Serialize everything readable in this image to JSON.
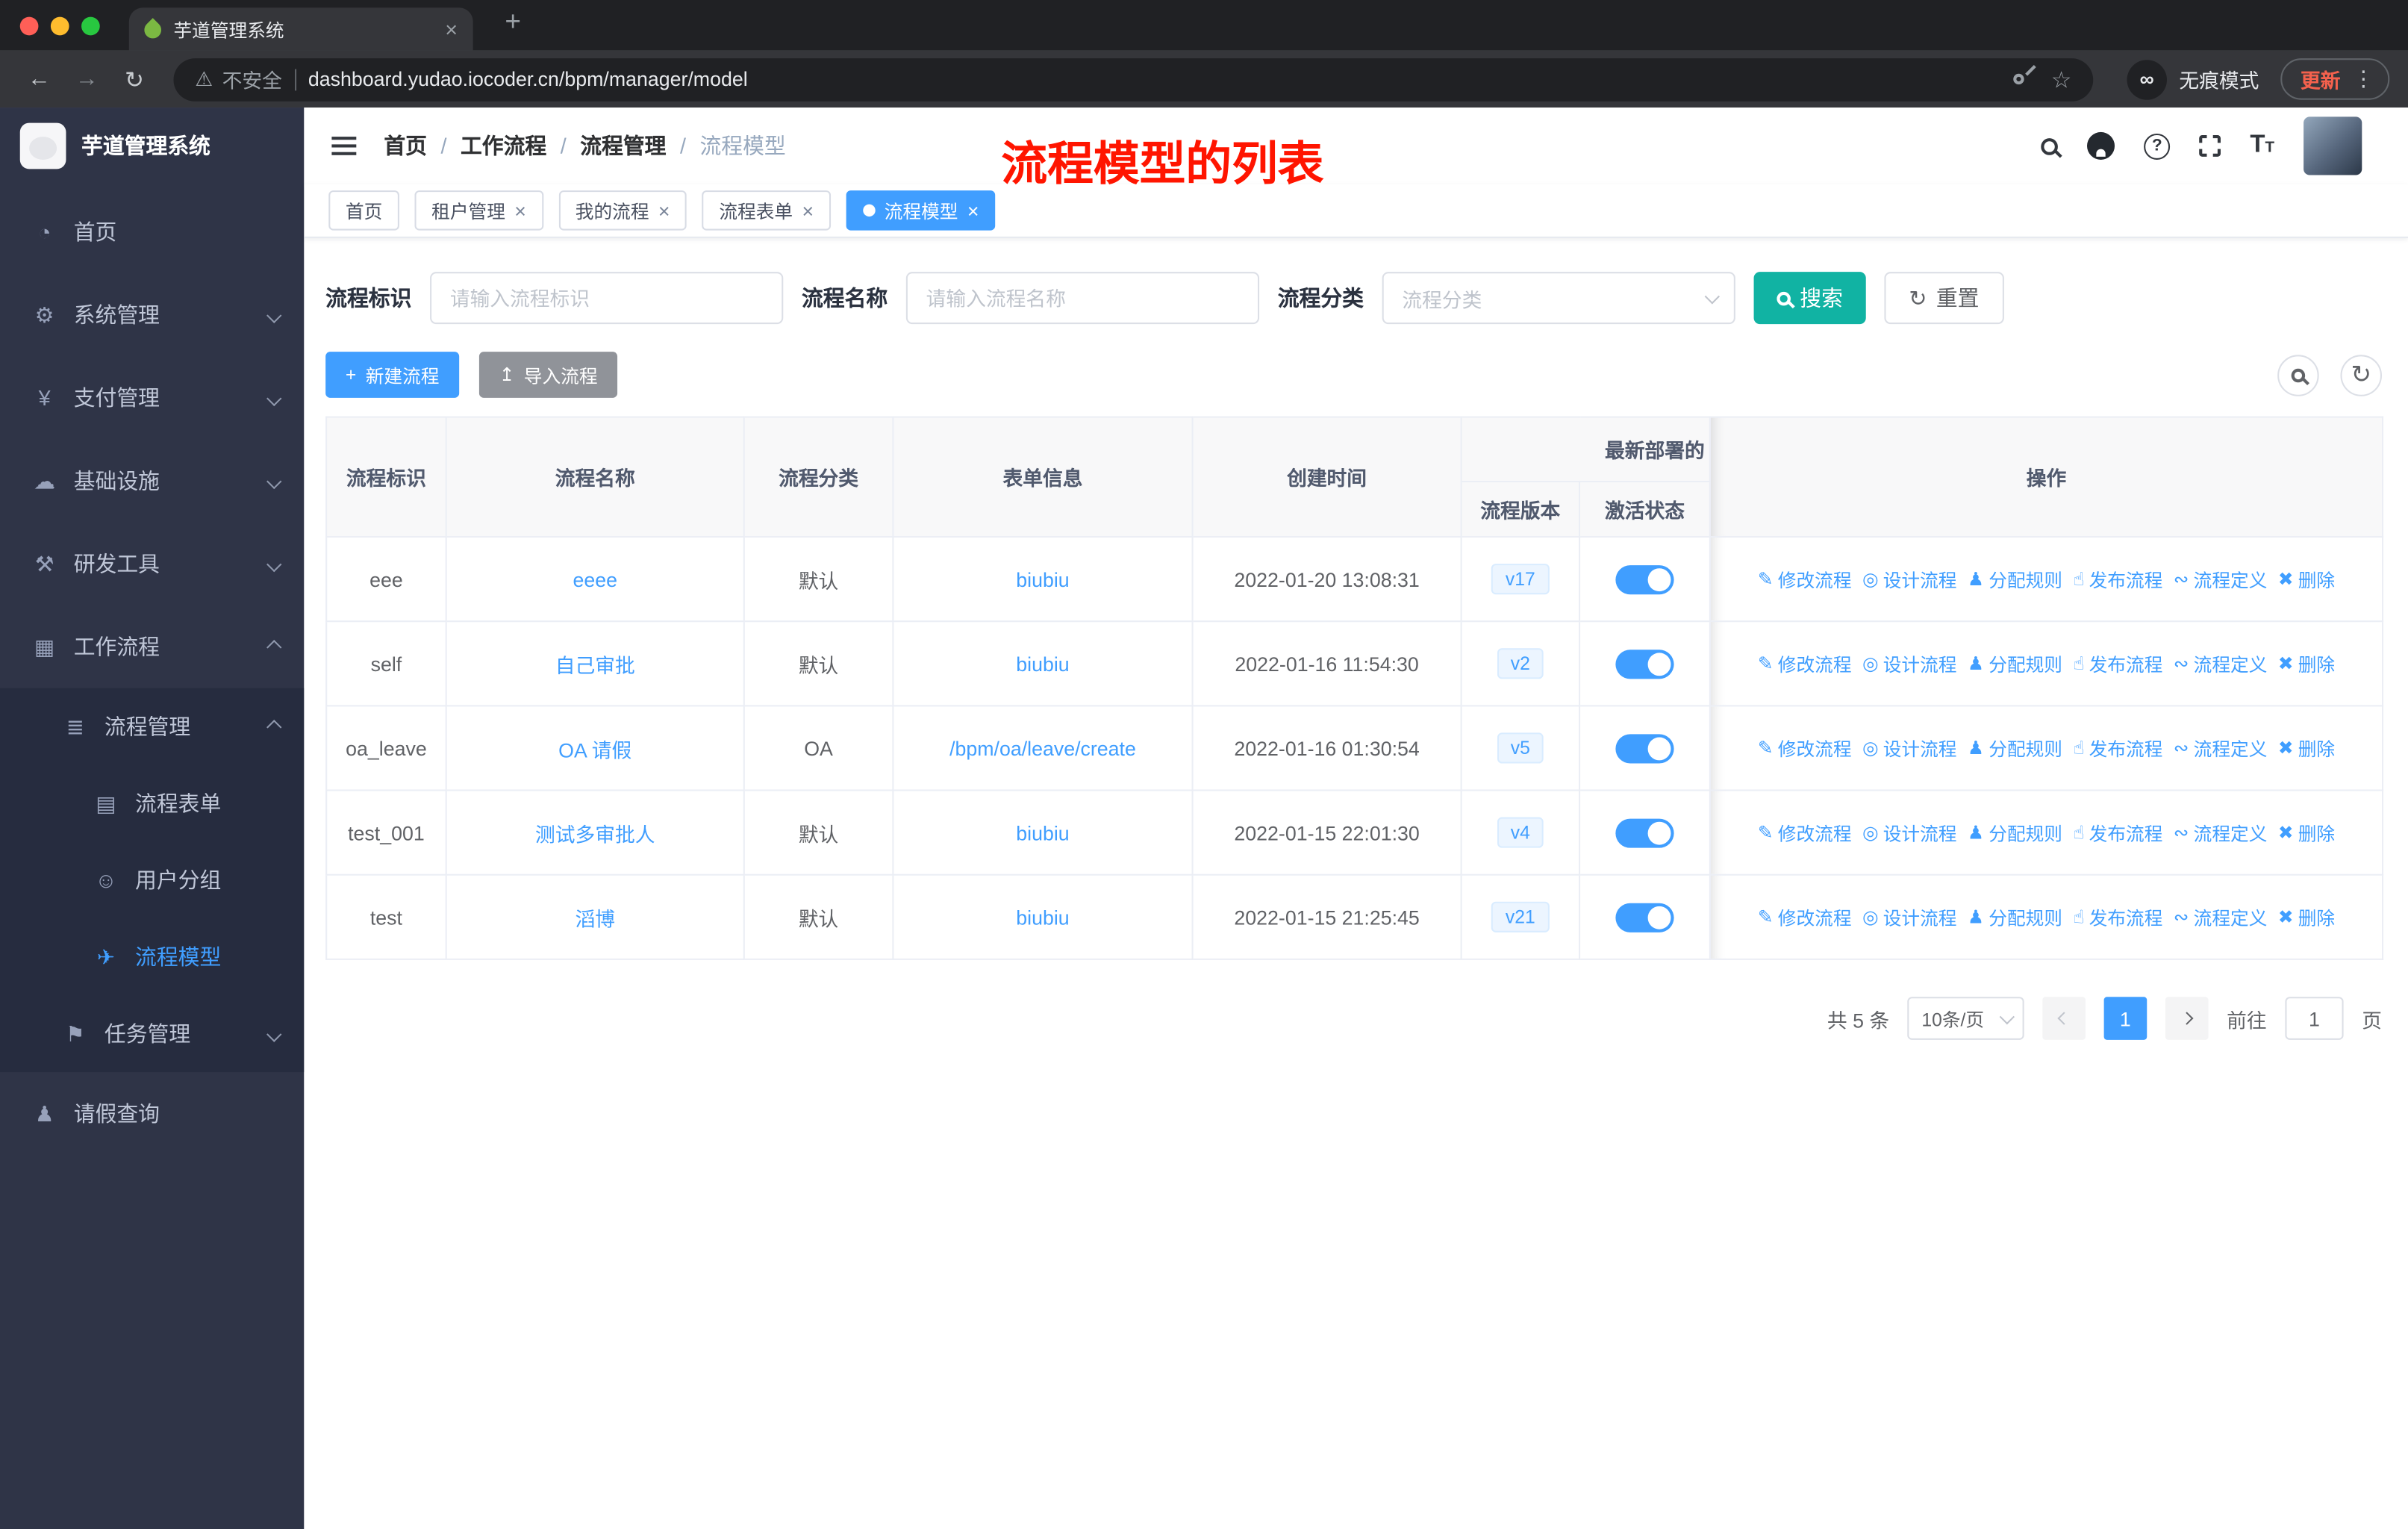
{
  "browser": {
    "tab_title": "芋道管理系统",
    "security_text": "不安全",
    "url": "dashboard.yudao.iocoder.cn/bpm/manager/model",
    "incognito_label": "无痕模式",
    "update_label": "更新"
  },
  "icons": {
    "close": "×",
    "plus": "+",
    "back": "←",
    "forward": "→",
    "reload": "↻",
    "star": "☆",
    "warning": "⚠",
    "dots": "⋮",
    "incognito": "∞",
    "question": "?",
    "home": "◔",
    "system": "⚙",
    "payment": "¥",
    "infrastructure": "☁",
    "devtools": "⚒",
    "workflow": "▦",
    "process_mgmt": "≣",
    "form": "▤",
    "user_group": "☺",
    "model": "✈",
    "task": "⚑",
    "leave": "♟",
    "edit": "✎",
    "design": "◎",
    "assign": "♟",
    "publish": "☝",
    "definition": "∾",
    "delete": "✖",
    "upload": "↥",
    "refresh": "↻"
  },
  "sidebar": {
    "logo_title": "芋道管理系统",
    "items": [
      {
        "label": "首页"
      },
      {
        "label": "系统管理"
      },
      {
        "label": "支付管理"
      },
      {
        "label": "基础设施"
      },
      {
        "label": "研发工具"
      },
      {
        "label": "工作流程"
      },
      {
        "label": "流程管理"
      },
      {
        "label": "流程表单"
      },
      {
        "label": "用户分组"
      },
      {
        "label": "流程模型"
      },
      {
        "label": "任务管理"
      },
      {
        "label": "请假查询"
      }
    ]
  },
  "header": {
    "breadcrumb": [
      "首页",
      "工作流程",
      "流程管理",
      "流程模型"
    ],
    "annotation": "流程模型的列表"
  },
  "tags": [
    {
      "label": "首页"
    },
    {
      "label": "租户管理"
    },
    {
      "label": "我的流程"
    },
    {
      "label": "流程表单"
    },
    {
      "label": "流程模型"
    }
  ],
  "filters": {
    "id_label": "流程标识",
    "id_placeholder": "请输入流程标识",
    "name_label": "流程名称",
    "name_placeholder": "请输入流程名称",
    "category_label": "流程分类",
    "category_placeholder": "流程分类",
    "search_label": "搜索",
    "reset_label": "重置"
  },
  "actions_bar": {
    "create_label": "新建流程",
    "import_label": "导入流程"
  },
  "table": {
    "headers": {
      "id": "流程标识",
      "name": "流程名称",
      "category": "流程分类",
      "form": "表单信息",
      "created": "创建时间",
      "deploy_group": "最新部署的",
      "version": "流程版本",
      "active": "激活状态",
      "ops": "操作"
    },
    "row_actions": [
      "修改流程",
      "设计流程",
      "分配规则",
      "发布流程",
      "流程定义",
      "删除"
    ],
    "rows": [
      {
        "id": "eee",
        "name": "eeee",
        "category": "默认",
        "form": "biubiu",
        "created": "2022-01-20 13:08:31",
        "version": "v17",
        "active": true
      },
      {
        "id": "self",
        "name": "自己审批",
        "category": "默认",
        "form": "biubiu",
        "created": "2022-01-16 11:54:30",
        "version": "v2",
        "active": true
      },
      {
        "id": "oa_leave",
        "name": "OA 请假",
        "category": "OA",
        "form": "/bpm/oa/leave/create",
        "created": "2022-01-16 01:30:54",
        "version": "v5",
        "active": true
      },
      {
        "id": "test_001",
        "name": "测试多审批人",
        "category": "默认",
        "form": "biubiu",
        "created": "2022-01-15 22:01:30",
        "version": "v4",
        "active": true
      },
      {
        "id": "test",
        "name": "滔博",
        "category": "默认",
        "form": "biubiu",
        "created": "2022-01-15 21:25:45",
        "version": "v21",
        "active": true
      }
    ]
  },
  "pagination": {
    "total": "共 5 条",
    "page_size": "10条/页",
    "current_page": "1",
    "goto_label": "前往",
    "goto_value": "1",
    "page_suffix": "页"
  },
  "colors": {
    "accent": "#409eff",
    "search_button": "#11b3a3",
    "sidebar_bg": "#2f3447",
    "submenu_bg": "#262c3f",
    "tag_active": "#409eff",
    "toggle_on": "#409eff",
    "link": "#409eff",
    "annotation": "#ff1500",
    "update_label": "#f4614d"
  }
}
